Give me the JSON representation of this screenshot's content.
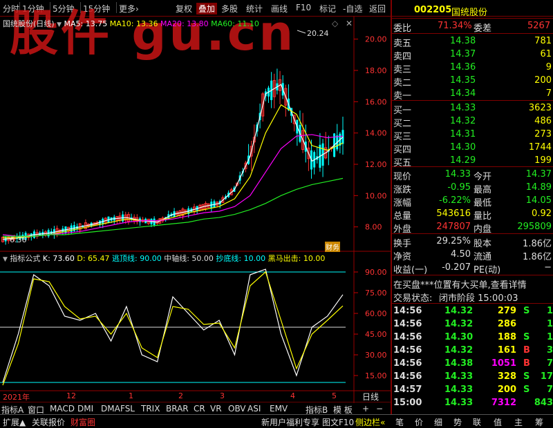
{
  "toolbar": {
    "left": [
      "分时",
      "1分钟",
      "5分钟",
      "15分钟",
      "更多›"
    ],
    "right": [
      "复权",
      "叠加",
      "多股",
      "统计",
      "画线",
      "F10",
      "标记",
      "-自选",
      "返回"
    ],
    "active_right": "叠加"
  },
  "watermark": "股件 gu.cn",
  "kline_legend": {
    "name": "国统股份(日线)",
    "ma5": "MA5: 13.75",
    "ma10": "MA10: 13.36",
    "ma20": "MA20: 13.80",
    "ma60": "MA60: 11.10",
    "high_label": "20.24",
    "low_label": "6.36",
    "tag": "财务"
  },
  "indicator_legend": {
    "name": "指标公式",
    "k": "K: 73.60",
    "d": "D: 65.47",
    "top": "逃顶线: 90.00",
    "mid": "中轴线: 50.00",
    "bottom": "抄底线: 10.00",
    "horse": "黑马出击: 10.00"
  },
  "price_axis": [
    "20.00",
    "18.00",
    "16.00",
    "14.00",
    "12.00",
    "10.00",
    "8.00"
  ],
  "ind_axis": [
    "90.00",
    "75.00",
    "60.00",
    "45.00",
    "30.00",
    "15.00"
  ],
  "date_axis": [
    "2021年",
    "12",
    "1",
    "2",
    "3",
    "4",
    "5"
  ],
  "date_axis_right": "日线",
  "indicator_tabs": [
    "指标A",
    "窗口",
    "MACD",
    "DMI",
    "DMA",
    "FSL",
    "TRIX",
    "BRAR",
    "CR",
    "VR",
    "OBV",
    "ASI",
    "EMV",
    "指标B",
    "模 板",
    "+",
    "−"
  ],
  "bottom": {
    "left": [
      "扩展▲",
      "关联报价",
      "财富圈"
    ],
    "right": [
      "新用户福利专享",
      "图文F10",
      "侧边栏«",
      "笔",
      "价",
      "细",
      "势",
      "联",
      "值",
      "主",
      "筹"
    ]
  },
  "quote": {
    "code": "002205",
    "name": "国统股份",
    "webi_label": "委比",
    "webi": "71.34%",
    "weicha_label": "委差",
    "weicha": "5267",
    "asks": [
      {
        "label": "卖五",
        "price": "14.38",
        "vol": "781"
      },
      {
        "label": "卖四",
        "price": "14.37",
        "vol": "61"
      },
      {
        "label": "卖三",
        "price": "14.36",
        "vol": "9"
      },
      {
        "label": "卖二",
        "price": "14.35",
        "vol": "200"
      },
      {
        "label": "卖一",
        "price": "14.34",
        "vol": "7"
      }
    ],
    "bids": [
      {
        "label": "买一",
        "price": "14.33",
        "vol": "3623"
      },
      {
        "label": "买二",
        "price": "14.32",
        "vol": "486"
      },
      {
        "label": "买三",
        "price": "14.31",
        "vol": "273"
      },
      {
        "label": "买四",
        "price": "14.30",
        "vol": "1744"
      },
      {
        "label": "买五",
        "price": "14.29",
        "vol": "199"
      }
    ],
    "stats": [
      {
        "l1": "现价",
        "v1": "14.33",
        "c1": "#2e2",
        "l2": "今开",
        "v2": "14.37",
        "c2": "#2e2"
      },
      {
        "l1": "涨跌",
        "v1": "-0.95",
        "c1": "#2e2",
        "l2": "最高",
        "v2": "14.89",
        "c2": "#2e2"
      },
      {
        "l1": "涨幅",
        "v1": "-6.22%",
        "c1": "#2e2",
        "l2": "最低",
        "v2": "14.05",
        "c2": "#2e2"
      },
      {
        "l1": "总量",
        "v1": "543616",
        "c1": "#ff0",
        "l2": "量比",
        "v2": "0.92",
        "c2": "#ff0"
      },
      {
        "l1": "外盘",
        "v1": "247807",
        "c1": "#f33",
        "l2": "内盘",
        "v2": "295809",
        "c2": "#2e2"
      }
    ],
    "stats2": [
      {
        "l1": "换手",
        "v1": "29.25%",
        "l2": "股本",
        "v2": "1.86亿"
      },
      {
        "l1": "净资",
        "v1": "4.50",
        "l2": "流通",
        "v2": "1.86亿"
      },
      {
        "l1": "收益(一)",
        "v1": "-0.207",
        "l2": "PE(动)",
        "v2": "−"
      }
    ],
    "notice": "在买盘***位置有大买单,查看详情",
    "status_label": "交易状态:",
    "status": "闭市阶段 15:00:03",
    "ticks": [
      {
        "t": "14:56",
        "p": "14.32",
        "v": "279",
        "s": "S"
      },
      {
        "t": "14:56",
        "p": "14.32",
        "v": "286",
        "s": ""
      },
      {
        "t": "14:56",
        "p": "14.30",
        "v": "188",
        "s": "S"
      },
      {
        "t": "14:56",
        "p": "14.32",
        "v": "161",
        "s": "B"
      },
      {
        "t": "14:56",
        "p": "14.38",
        "v": "1051",
        "s": "B"
      },
      {
        "t": "14:56",
        "p": "14.33",
        "v": "328",
        "s": "S"
      },
      {
        "t": "14:57",
        "p": "14.33",
        "v": "200",
        "s": "S"
      },
      {
        "t": "15:00",
        "p": "14.33",
        "v": "7312",
        "s": ""
      }
    ],
    "tick_trailing": [
      "1",
      "1",
      "1",
      "3",
      "7",
      "17",
      "7",
      "843"
    ]
  },
  "chart_data": [
    {
      "type": "line",
      "title": "国统股份(日线)",
      "ylim": [
        6,
        21
      ],
      "series": [
        {
          "name": "MA5",
          "values": [
            7.2,
            7.3,
            7.5,
            7.6,
            7.8,
            8.0,
            8.2,
            8.5,
            8.6,
            8.4,
            8.3,
            8.8,
            9.0,
            9.3,
            9.5,
            10.4,
            12.5,
            16.5,
            17.1,
            14.5,
            12.2,
            12.8,
            13.75
          ]
        },
        {
          "name": "MA10",
          "values": [
            7.3,
            7.3,
            7.4,
            7.5,
            7.7,
            7.9,
            8.1,
            8.3,
            8.5,
            8.4,
            8.4,
            8.6,
            8.9,
            9.1,
            9.3,
            9.8,
            11.2,
            14.0,
            15.8,
            15.2,
            13.2,
            12.9,
            13.36
          ]
        },
        {
          "name": "MA20",
          "values": [
            7.5,
            7.4,
            7.4,
            7.5,
            7.6,
            7.7,
            7.9,
            8.1,
            8.3,
            8.4,
            8.4,
            8.5,
            8.7,
            8.9,
            9.0,
            9.3,
            10.0,
            11.5,
            13.0,
            13.8,
            13.9,
            13.7,
            13.8
          ]
        },
        {
          "name": "MA60",
          "values": [
            7.4,
            7.4,
            7.4,
            7.5,
            7.5,
            7.6,
            7.7,
            7.8,
            7.9,
            8.0,
            8.1,
            8.2,
            8.3,
            8.5,
            8.6,
            8.8,
            9.1,
            9.5,
            10.0,
            10.4,
            10.7,
            10.9,
            11.1
          ]
        }
      ]
    },
    {
      "type": "line",
      "title": "指标公式",
      "ylim": [
        5,
        100
      ],
      "series": [
        {
          "name": "K",
          "values": [
            10,
            45,
            88,
            80,
            58,
            55,
            60,
            40,
            65,
            30,
            25,
            72,
            60,
            48,
            55,
            30,
            88,
            92,
            45,
            15,
            50,
            58,
            73.6
          ]
        },
        {
          "name": "D",
          "values": [
            8,
            38,
            85,
            83,
            65,
            56,
            58,
            45,
            60,
            35,
            28,
            65,
            63,
            52,
            53,
            35,
            80,
            90,
            55,
            20,
            45,
            55,
            65.47
          ]
        }
      ]
    }
  ]
}
